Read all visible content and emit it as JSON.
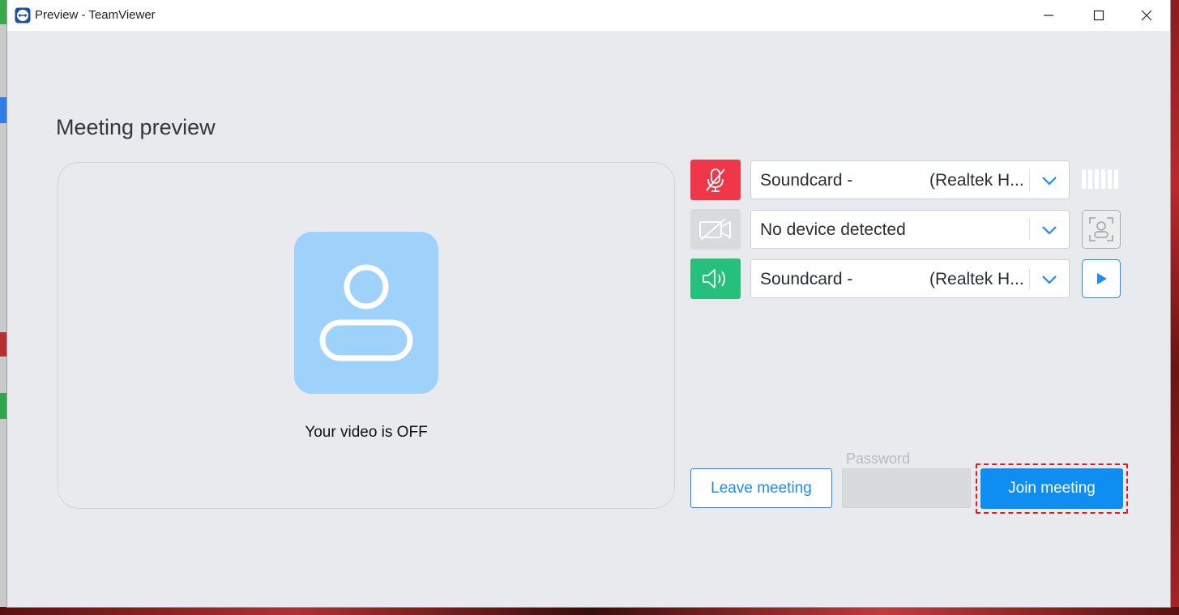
{
  "window": {
    "title": "Preview - TeamViewer"
  },
  "titlebar_buttons": [
    "minimize-icon",
    "maximize-icon",
    "close-icon"
  ],
  "heading": "Meeting preview",
  "video": {
    "status_text": "Your video is OFF"
  },
  "devices": {
    "microphone": {
      "icon": "microphone-muted-icon",
      "value_left": "Soundcard -",
      "value_right": "(Realtek H...",
      "muted": true,
      "color": "#f0374a"
    },
    "camera": {
      "icon": "camera-off-icon",
      "value_left": "No device detected",
      "value_right": "",
      "enabled": false,
      "color": "#d9dadc"
    },
    "speaker": {
      "icon": "speaker-icon",
      "value_left": "Soundcard -",
      "value_right": "(Realtek H...",
      "color": "#26bf7c"
    }
  },
  "buttons": {
    "leave": "Leave meeting",
    "join": "Join meeting"
  },
  "password": {
    "label": "Password",
    "value": ""
  },
  "accent": "#0e8ef0"
}
